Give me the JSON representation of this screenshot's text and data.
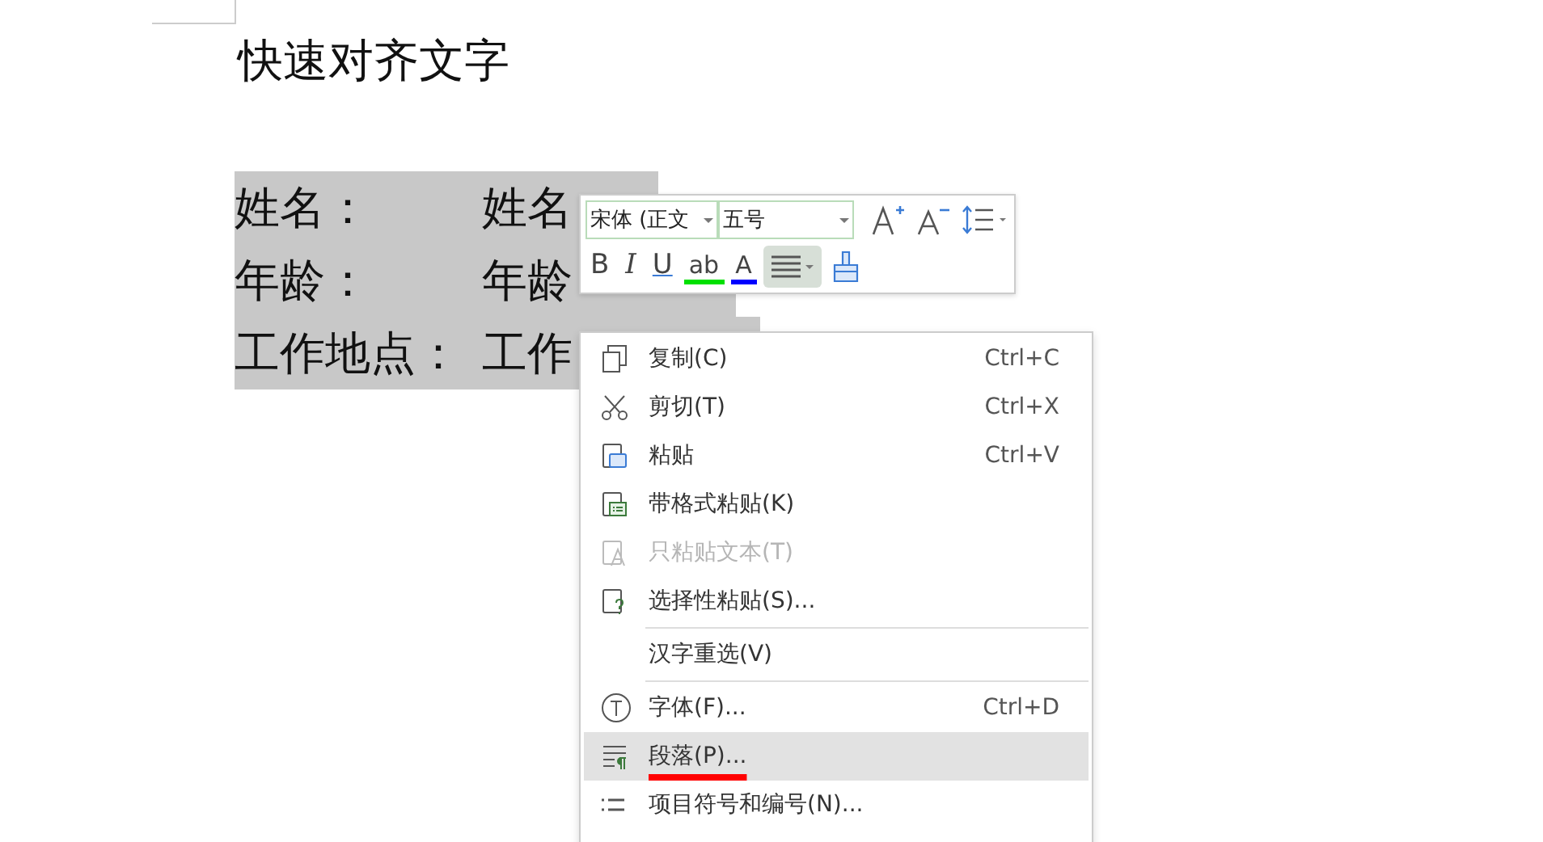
{
  "document": {
    "title": "快速对齐文字",
    "lines": [
      {
        "label": "姓名：",
        "value": "姓名",
        "selected": true
      },
      {
        "label": "年龄：",
        "value": "年龄",
        "selected": true
      },
      {
        "label": "工作地点：",
        "value": "工作",
        "selected": true
      }
    ]
  },
  "mini_toolbar": {
    "font": "宋体 (正文",
    "size": "五号",
    "row1": [
      {
        "kind": "grow-font",
        "active": false
      },
      {
        "kind": "shrink-font",
        "active": false
      },
      {
        "kind": "line-spacing",
        "active": false
      }
    ],
    "row2": [
      {
        "kind": "bold",
        "label": "B",
        "active": false
      },
      {
        "kind": "italic",
        "label": "I",
        "active": false
      },
      {
        "kind": "underline",
        "label": "U",
        "active": false
      },
      {
        "kind": "highlight",
        "label": "ab",
        "color": "#00e000",
        "active": false
      },
      {
        "kind": "font-color",
        "label": "A",
        "color": "#0000ff",
        "active": false
      },
      {
        "kind": "align",
        "active": true
      },
      {
        "kind": "format-painter",
        "active": false
      }
    ]
  },
  "context_menu": [
    {
      "kind": "item",
      "label": "复制(C)",
      "shortcut": "Ctrl+C",
      "disabled": false,
      "selected": false
    },
    {
      "kind": "item",
      "label": "剪切(T)",
      "shortcut": "Ctrl+X",
      "disabled": false,
      "selected": false
    },
    {
      "kind": "item",
      "label": "粘贴",
      "shortcut": "Ctrl+V",
      "disabled": false,
      "selected": false
    },
    {
      "kind": "item",
      "label": "带格式粘贴(K)",
      "disabled": false,
      "selected": false
    },
    {
      "kind": "item",
      "label": "只粘贴文本(T)",
      "disabled": true,
      "selected": false
    },
    {
      "kind": "item",
      "label": "选择性粘贴(S)...",
      "disabled": false,
      "selected": false
    },
    {
      "kind": "separator"
    },
    {
      "kind": "item",
      "label": "汉字重选(V)",
      "disabled": false,
      "selected": false
    },
    {
      "kind": "separator"
    },
    {
      "kind": "item",
      "label": "字体(F)...",
      "shortcut": "Ctrl+D",
      "disabled": false,
      "selected": false
    },
    {
      "kind": "item",
      "label": "段落(P)...",
      "disabled": false,
      "selected": true,
      "underlined": true
    },
    {
      "kind": "item",
      "label": "项目符号和编号(N)...",
      "disabled": false,
      "selected": false
    }
  ]
}
